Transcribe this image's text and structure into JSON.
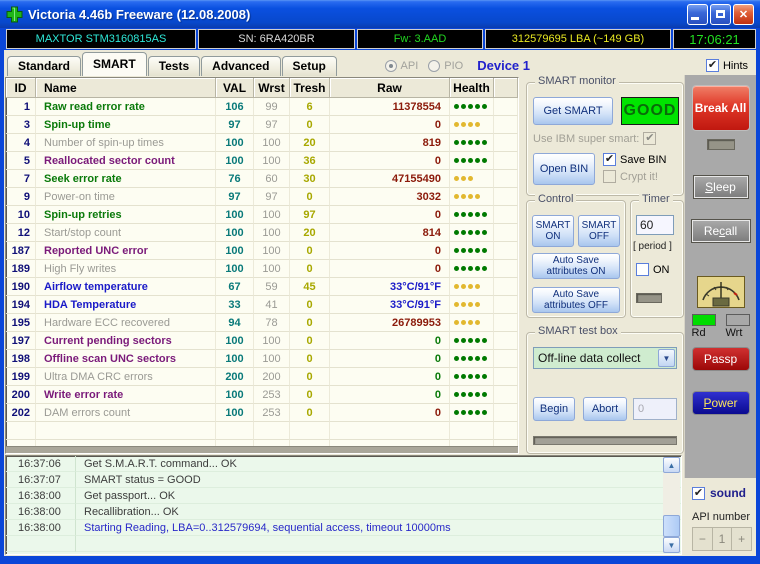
{
  "colors": {
    "titlebar_blue": "#0a50e0",
    "window_border_blue": "#0a46d8",
    "status_good_bg": "#00e400",
    "status_good_text": "#0a6a0a",
    "model_text": "#2ee8d8",
    "firmware_text": "#22d822",
    "capacity_text": "#e8e822",
    "clock_text": "#22e022",
    "dot_green": "#007a00",
    "dot_yellow": "#e2b830",
    "raw_red": "#8b1a0a",
    "raw_blue": "#1a1ac8",
    "raw_green": "#0a7a0a",
    "break_all_red": "#d42020",
    "passp_red": "#b01010",
    "power_blue": "#101090",
    "rd_indicator_green": "#00dc00",
    "wrt_indicator_gray": "#a8a8a8",
    "log_bg": "#ebf8eb",
    "table_bg": "#fdfdf2"
  },
  "window": {
    "title": "Victoria 4.46b Freeware (12.08.2008)"
  },
  "info_bar": {
    "model": "MAXTOR STM3160815AS",
    "serial": "SN: 6RA420BR",
    "firmware": "Fw: 3.AAD",
    "capacity": "312579695 LBA (~149 GB)",
    "time": "17:06:21"
  },
  "tab_bar": {
    "tabs": [
      {
        "label": "Standard",
        "active": false
      },
      {
        "label": "SMART",
        "active": true
      },
      {
        "label": "Tests",
        "active": false
      },
      {
        "label": "Advanced",
        "active": false
      },
      {
        "label": "Setup",
        "active": false
      }
    ],
    "api_label": "API",
    "pio_label": "PIO",
    "device_label": "Device 1",
    "hints_label": "Hints"
  },
  "table": {
    "headers": [
      "ID",
      "Name",
      "VAL",
      "Wrst",
      "Tresh",
      "Raw",
      "Health"
    ],
    "rows": [
      {
        "id": "1",
        "name": "Raw read error rate",
        "name_color": "green",
        "val": "106",
        "wrst": "99",
        "tresh": "6",
        "raw": "11378554",
        "raw_color": "red",
        "health_count": 5,
        "health_color": "green"
      },
      {
        "id": "3",
        "name": "Spin-up time",
        "name_color": "green",
        "val": "97",
        "wrst": "97",
        "tresh": "0",
        "raw": "0",
        "raw_color": "red",
        "health_count": 4,
        "health_color": "yellow"
      },
      {
        "id": "4",
        "name": "Number of spin-up times",
        "name_color": "gray",
        "val": "100",
        "wrst": "100",
        "tresh": "20",
        "raw": "819",
        "raw_color": "red",
        "health_count": 5,
        "health_color": "green"
      },
      {
        "id": "5",
        "name": "Reallocated sector count",
        "name_color": "purple",
        "val": "100",
        "wrst": "100",
        "tresh": "36",
        "raw": "0",
        "raw_color": "red",
        "health_count": 5,
        "health_color": "green"
      },
      {
        "id": "7",
        "name": "Seek error rate",
        "name_color": "green",
        "val": "76",
        "wrst": "60",
        "tresh": "30",
        "raw": "47155490",
        "raw_color": "red",
        "health_count": 3,
        "health_color": "yellow"
      },
      {
        "id": "9",
        "name": "Power-on time",
        "name_color": "gray",
        "val": "97",
        "wrst": "97",
        "tresh": "0",
        "raw": "3032",
        "raw_color": "red",
        "health_count": 4,
        "health_color": "yellow"
      },
      {
        "id": "10",
        "name": "Spin-up retries",
        "name_color": "green",
        "val": "100",
        "wrst": "100",
        "tresh": "97",
        "raw": "0",
        "raw_color": "red",
        "health_count": 5,
        "health_color": "green"
      },
      {
        "id": "12",
        "name": "Start/stop count",
        "name_color": "gray",
        "val": "100",
        "wrst": "100",
        "tresh": "20",
        "raw": "814",
        "raw_color": "red",
        "health_count": 5,
        "health_color": "green"
      },
      {
        "id": "187",
        "name": "Reported UNC error",
        "name_color": "purple",
        "val": "100",
        "wrst": "100",
        "tresh": "0",
        "raw": "0",
        "raw_color": "red",
        "health_count": 5,
        "health_color": "green"
      },
      {
        "id": "189",
        "name": "High Fly writes",
        "name_color": "gray",
        "val": "100",
        "wrst": "100",
        "tresh": "0",
        "raw": "0",
        "raw_color": "red",
        "health_count": 5,
        "health_color": "green"
      },
      {
        "id": "190",
        "name": "Airflow temperature",
        "name_color": "blue",
        "val": "67",
        "wrst": "59",
        "tresh": "45",
        "raw": "33°C/91°F",
        "raw_color": "blue",
        "health_count": 4,
        "health_color": "yellow"
      },
      {
        "id": "194",
        "name": "HDA Temperature",
        "name_color": "blue",
        "val": "33",
        "wrst": "41",
        "tresh": "0",
        "raw": "33°C/91°F",
        "raw_color": "blue",
        "health_count": 4,
        "health_color": "yellow"
      },
      {
        "id": "195",
        "name": "Hardware ECC recovered",
        "name_color": "gray",
        "val": "94",
        "wrst": "78",
        "tresh": "0",
        "raw": "26789953",
        "raw_color": "red",
        "health_count": 4,
        "health_color": "yellow"
      },
      {
        "id": "197",
        "name": "Current pending sectors",
        "name_color": "purple",
        "val": "100",
        "wrst": "100",
        "tresh": "0",
        "raw": "0",
        "raw_color": "green",
        "health_count": 5,
        "health_color": "green"
      },
      {
        "id": "198",
        "name": "Offline scan UNC sectors",
        "name_color": "purple",
        "val": "100",
        "wrst": "100",
        "tresh": "0",
        "raw": "0",
        "raw_color": "green",
        "health_count": 5,
        "health_color": "green"
      },
      {
        "id": "199",
        "name": "Ultra DMA CRC errors",
        "name_color": "gray",
        "val": "200",
        "wrst": "200",
        "tresh": "0",
        "raw": "0",
        "raw_color": "green",
        "health_count": 5,
        "health_color": "green"
      },
      {
        "id": "200",
        "name": "Write error rate",
        "name_color": "purple",
        "val": "100",
        "wrst": "253",
        "tresh": "0",
        "raw": "0",
        "raw_color": "green",
        "health_count": 5,
        "health_color": "green"
      },
      {
        "id": "202",
        "name": "DAM errors count",
        "name_color": "gray",
        "val": "100",
        "wrst": "253",
        "tresh": "0",
        "raw": "0",
        "raw_color": "red",
        "health_count": 5,
        "health_color": "green"
      }
    ]
  },
  "smart_monitor": {
    "title": "SMART monitor",
    "get_smart": "Get SMART",
    "status": "GOOD",
    "ibm_label": "Use IBM super smart:",
    "open_bin": "Open BIN",
    "save_bin": "Save BIN",
    "crypt_it": "Crypt it!"
  },
  "control_box": {
    "title": "Control",
    "smart_on": "SMART ON",
    "smart_off": "SMART OFF",
    "autosave_on": "Auto Save attributes ON",
    "autosave_off": "Auto Save attributes OFF"
  },
  "timer_box": {
    "title": "Timer",
    "value": "60",
    "period_label": "[ period ]",
    "on_label": "ON"
  },
  "test_box": {
    "title": "SMART test box",
    "selected_test": "Off-line data collect",
    "begin": "Begin",
    "abort": "Abort",
    "counter": "0"
  },
  "side_panel": {
    "break_all": "Break All",
    "sleep": {
      "label": "Sleep",
      "hotkey": "S"
    },
    "recall": {
      "label": "Recall",
      "hotkey": "c"
    },
    "rd_label": "Rd",
    "wrt_label": "Wrt",
    "passp": "Passp",
    "power": {
      "label": "Power",
      "hotkey": "P"
    }
  },
  "log": {
    "entries": [
      {
        "time": "16:37:06",
        "message": "Get S.M.A.R.T. command... OK",
        "color": "normal"
      },
      {
        "time": "16:37:07",
        "message": "SMART status = GOOD",
        "color": "normal"
      },
      {
        "time": "16:38:00",
        "message": "Get passport... OK",
        "color": "normal"
      },
      {
        "time": "16:38:00",
        "message": "Recallibration... OK",
        "color": "normal"
      },
      {
        "time": "16:38:00",
        "message": "Starting Reading, LBA=0..312579694, sequential access, timeout 10000ms",
        "color": "blue"
      }
    ]
  },
  "bottom_right": {
    "sound_label": "sound",
    "api_number_label": "API number",
    "api_value": "1",
    "minus": "−",
    "plus": "+"
  }
}
